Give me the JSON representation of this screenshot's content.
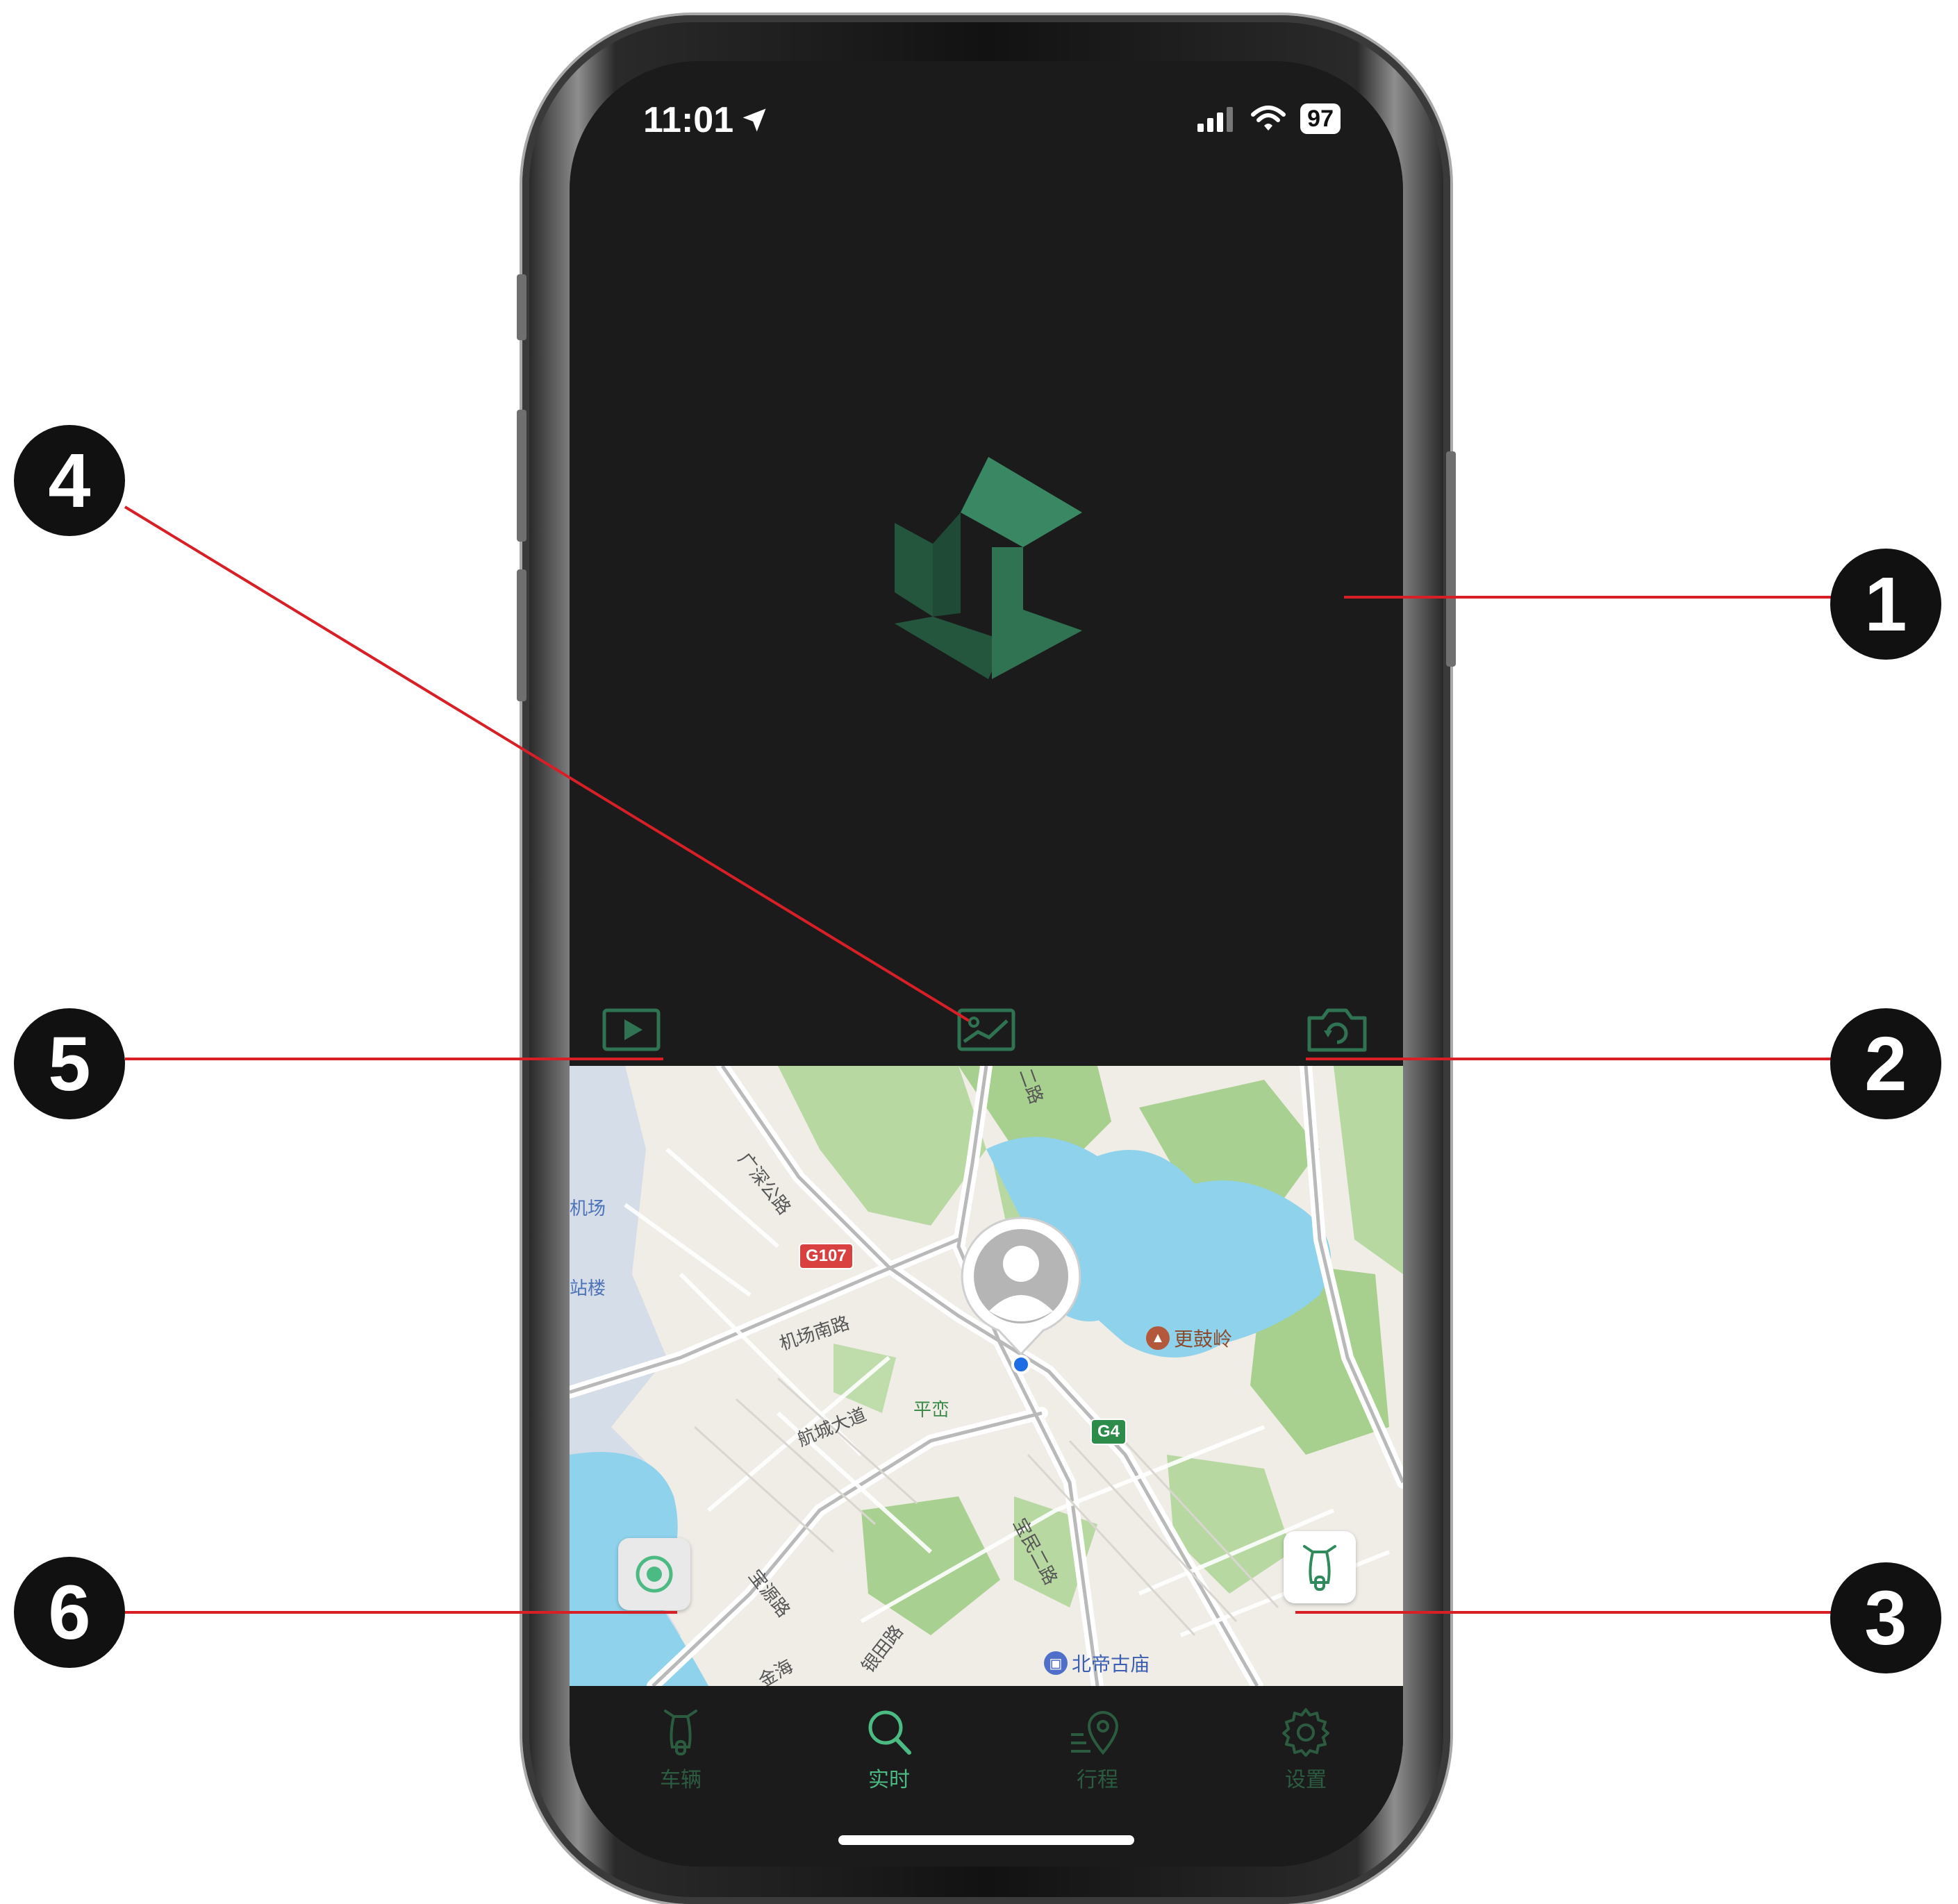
{
  "status_bar": {
    "time": "11:01",
    "battery": "97"
  },
  "toolbar": {
    "play_icon": "play-icon",
    "image_icon": "image-icon",
    "camera_icon": "switch-camera-icon"
  },
  "map": {
    "labels": {
      "airport": "机场",
      "terminal": "站楼",
      "guangshen": "广深公路",
      "airport_south": "机场南路",
      "hangcheng": "航城大道",
      "pingluan": "平峦",
      "genggu": "更鼓岭",
      "baomin": "宝民二路",
      "baoyuan": "宝源路",
      "yintian": "银田路",
      "beidi": "北帝古庙",
      "jinhai": "金海",
      "road_2": "二路"
    },
    "shields": {
      "g107": "G107",
      "g4": "G4"
    },
    "locate_icon": "locate-target-icon",
    "vehicle_icon": "scooter-icon"
  },
  "tabs": [
    {
      "label": "车辆",
      "icon": "scooter-icon",
      "active": false
    },
    {
      "label": "实时",
      "icon": "search-icon",
      "active": true
    },
    {
      "label": "行程",
      "icon": "route-pin-icon",
      "active": false
    },
    {
      "label": "设置",
      "icon": "gear-icon",
      "active": false
    }
  ],
  "callouts": [
    "1",
    "2",
    "3",
    "4",
    "5",
    "6"
  ],
  "colors": {
    "accent": "#4cbb83",
    "inactive": "#2c5c40",
    "callout_line": "#d81f26"
  }
}
